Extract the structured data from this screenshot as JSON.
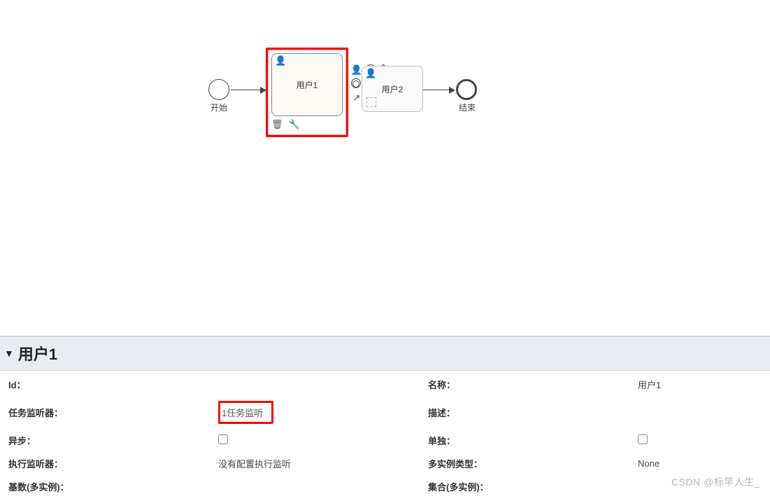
{
  "diagram": {
    "start_label": "开始",
    "end_label": "结束",
    "task1_label": "用户1",
    "task2_label": "用户2",
    "ctx_delete": "🗑",
    "ctx_wrench": "🔧"
  },
  "panel": {
    "title": "用户1",
    "labels": {
      "id": "Id：",
      "name": "名称：",
      "task_listener": "任务监听器：",
      "desc": "描述：",
      "async": "异步：",
      "exclusive": "单独：",
      "exec_listener": "执行监听器：",
      "multi_type": "多实例类型：",
      "cardinality": "基数(多实例)：",
      "collection": "集合(多实例)："
    },
    "values": {
      "id": "",
      "name": "用户1",
      "task_listener": "1任务监听",
      "desc": "",
      "exec_listener": "没有配置执行监听",
      "multi_type": "None"
    }
  },
  "watermark": "CSDN @标竿人生_"
}
